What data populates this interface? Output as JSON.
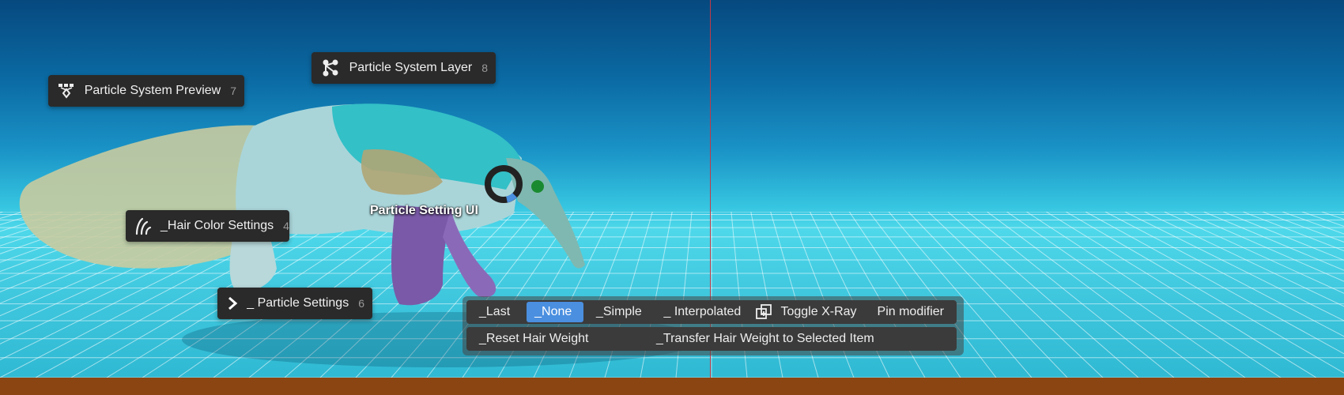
{
  "pie_menu": {
    "title": "Particle Setting UI",
    "items": [
      {
        "label": "Particle System Preview",
        "key": "7",
        "icon": "particle-preview-icon"
      },
      {
        "label": "Particle System Layer",
        "key": "8",
        "icon": "node-graph-icon"
      },
      {
        "label": "_Hair Color Settings",
        "key": "4",
        "icon": "hair-strands-icon"
      },
      {
        "label": "_ Particle Settings",
        "key": "6",
        "icon": "chevron-right-icon"
      }
    ]
  },
  "toolbar": {
    "row1": [
      {
        "label": "_Last",
        "active": false
      },
      {
        "label": "_None",
        "active": true
      },
      {
        "label": "_Simple",
        "active": false
      },
      {
        "label": "_ Interpolated",
        "active": false
      },
      {
        "label": "Toggle X-Ray",
        "active": false,
        "icon": "xray-icon"
      },
      {
        "label": "Pin modifier",
        "active": false
      }
    ],
    "row2": [
      {
        "label": "_Reset Hair Weight"
      },
      {
        "label": "_Transfer Hair Weight to Selected Item"
      }
    ]
  },
  "colors": {
    "accent": "#4a8fe0",
    "menu_bg": "#2a2a2a",
    "ground": "#8b4513",
    "cursor_line": "#c23a47"
  }
}
